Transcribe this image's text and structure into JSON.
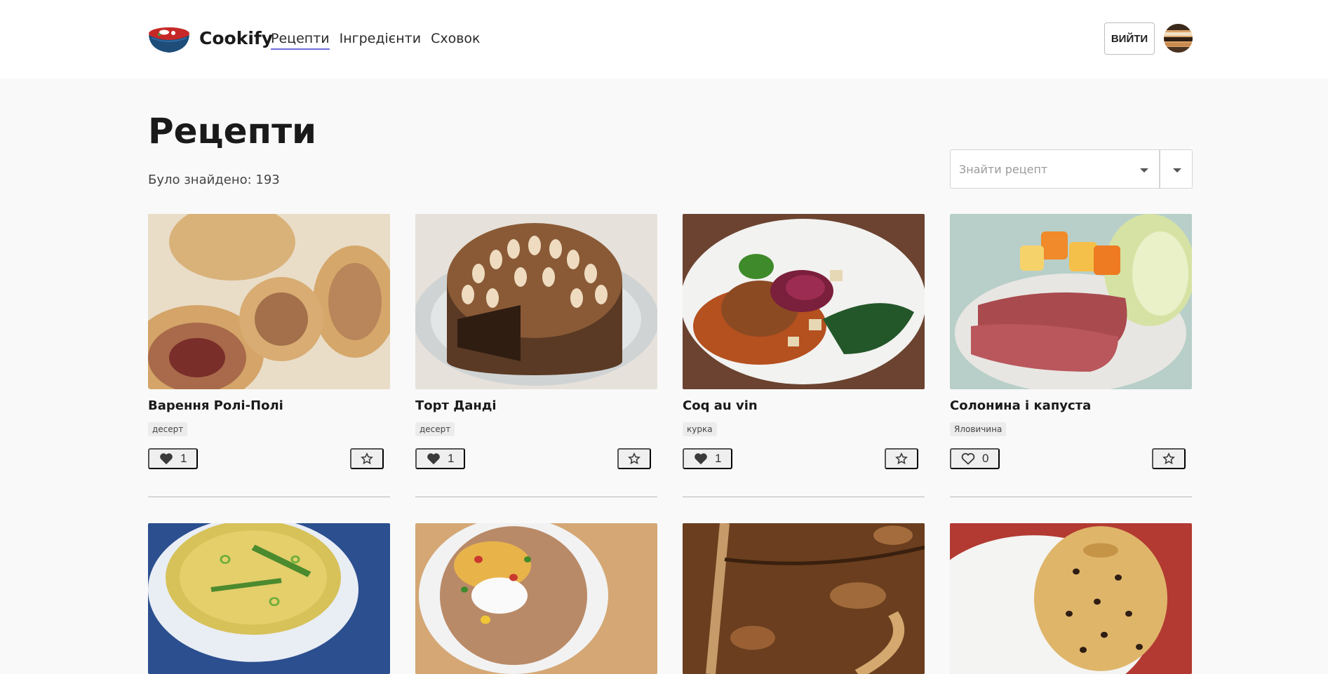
{
  "header": {
    "brand": "Cookify",
    "nav": [
      {
        "label": "Рецепти",
        "active": true
      },
      {
        "label": "Інгредієнти",
        "active": false
      },
      {
        "label": "Сховок",
        "active": false
      }
    ],
    "logout_label": "ВИЙТИ"
  },
  "page": {
    "title": "Рецепти",
    "count_text": "Було знайдено: 193"
  },
  "search": {
    "placeholder": "Знайти рецепт"
  },
  "recipes": [
    {
      "name": "Варення Ролі-Полі",
      "tag": "десерт",
      "likes": "1",
      "liked": true,
      "photo": "roly-poly"
    },
    {
      "name": "Торт Данді",
      "tag": "десерт",
      "likes": "1",
      "liked": true,
      "photo": "dundee-cake"
    },
    {
      "name": "Coq au vin",
      "tag": "курка",
      "likes": "1",
      "liked": true,
      "photo": "coq-au-vin"
    },
    {
      "name": "Солонина і капуста",
      "tag": "Яловичина",
      "likes": "0",
      "liked": false,
      "photo": "corned-beef"
    },
    {
      "photo": "egg-drop-soup"
    },
    {
      "photo": "stuffed-potato"
    },
    {
      "photo": "pecan-pie"
    },
    {
      "photo": "spotted-pudding"
    }
  ],
  "colors": {
    "accent_underline": "#6b6fd8",
    "page_background": "#f9f9f9"
  }
}
